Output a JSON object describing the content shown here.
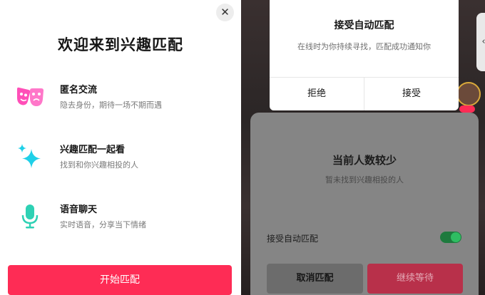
{
  "colors": {
    "primary": "#fe2c55",
    "icon_pink": "#ff4fb8",
    "icon_cyan": "#1fd0e8",
    "toggle_on": "#2fbd62",
    "overlay_gray": "#858585"
  },
  "welcome": {
    "close_icon": "close-icon",
    "title": "欢迎来到兴趣匹配",
    "features": [
      {
        "icon": "masks-icon",
        "title": "匿名交流",
        "subtitle": "隐去身份，期待一场不期而遇"
      },
      {
        "icon": "sparkle-icon",
        "title": "兴趣匹配一起看",
        "subtitle": "找到和你兴趣相投的人"
      },
      {
        "icon": "microphone-icon",
        "title": "语音聊天",
        "subtitle": "实时语音，分享当下情绪"
      }
    ],
    "start_button": "开始匹配"
  },
  "auto_match_dialog": {
    "title": "接受自动匹配",
    "description": "在线时为你持续寻找，匹配成功通知你",
    "reject_label": "拒绝",
    "accept_label": "接受"
  },
  "few_people_panel": {
    "title": "当前人数较少",
    "subtitle": "暂未找到兴趣相投的人",
    "auto_match_label": "接受自动匹配",
    "auto_match_enabled": true,
    "cancel_label": "取消匹配",
    "continue_label": "继续等待"
  },
  "side_tab": {
    "icon": "chevron-left-icon",
    "glyph": "‹"
  }
}
